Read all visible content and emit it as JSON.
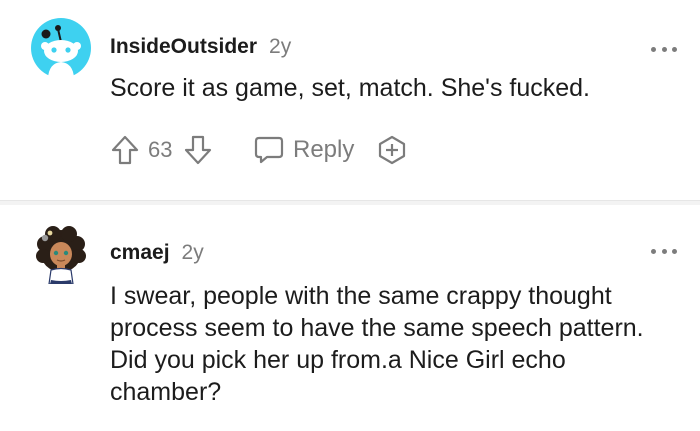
{
  "comments": [
    {
      "username": "InsideOutsider",
      "age": "2y",
      "body": "Score it as game, set, match. She's fucked.",
      "score": "63",
      "reply_label": "Reply"
    },
    {
      "username": "cmaej",
      "age": "2y",
      "body": "I swear, people with the same crappy thought process seem to have the same speech pattern. Did you pick her up from.a Nice Girl echo chamber?"
    }
  ],
  "icons": {
    "avatar_1": "reddit-snoo-avatar-icon",
    "avatar_2": "custom-character-avatar-icon",
    "more": "more-horizontal-icon",
    "upvote": "upvote-arrow-icon",
    "downvote": "downvote-arrow-icon",
    "reply": "speech-bubble-icon",
    "award": "add-award-icon"
  },
  "colors": {
    "avatar_1_bg": "#3ed1f0",
    "muted_text": "#7c7c7c",
    "divider": "#f3f3f3"
  }
}
